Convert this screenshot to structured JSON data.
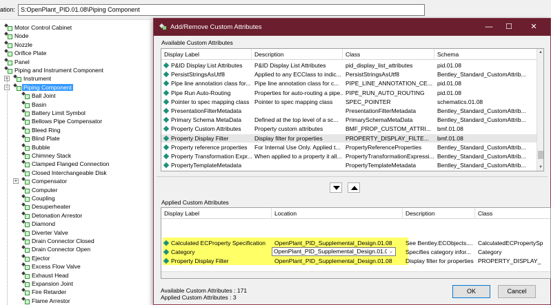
{
  "location": {
    "label": "ation:",
    "value": "S:OpenPlant_PID.01.08\\Piping Component"
  },
  "tree": {
    "items": [
      {
        "label": "Motor Control Cabinet",
        "level": 0
      },
      {
        "label": "Node",
        "level": 0
      },
      {
        "label": "Nozzle",
        "level": 0
      },
      {
        "label": "Orifice Plate",
        "level": 0
      },
      {
        "label": "Panel",
        "level": 0
      },
      {
        "label": "Piping and Instrument Component",
        "level": 0
      },
      {
        "label": "Instrument",
        "level": 1
      },
      {
        "label": "Piping Component",
        "level": 1,
        "selected": true
      },
      {
        "label": "Ball Joint",
        "level": 2
      },
      {
        "label": "Basin",
        "level": 2
      },
      {
        "label": "Battery Limit Symbol",
        "level": 2
      },
      {
        "label": "Bellows Pipe Compensator",
        "level": 2
      },
      {
        "label": "Bleed Ring",
        "level": 2
      },
      {
        "label": "Blind Plate",
        "level": 2
      },
      {
        "label": "Bubble",
        "level": 2
      },
      {
        "label": "Chimney Stack",
        "level": 2
      },
      {
        "label": "Clamped Flanged Connection",
        "level": 2
      },
      {
        "label": "Closed Interchangeable Disk",
        "level": 2
      },
      {
        "label": "Compensator",
        "level": 2
      },
      {
        "label": "Computer",
        "level": 2
      },
      {
        "label": "Coupling",
        "level": 2
      },
      {
        "label": "Desuperheater",
        "level": 2
      },
      {
        "label": "Detonation Arrestor",
        "level": 2
      },
      {
        "label": "Diamond",
        "level": 2
      },
      {
        "label": "Diverter Valve",
        "level": 2
      },
      {
        "label": "Drain Connector Closed",
        "level": 2
      },
      {
        "label": "Drain Connector Open",
        "level": 2
      },
      {
        "label": "Ejector",
        "level": 2
      },
      {
        "label": "Excess Flow Valve",
        "level": 2
      },
      {
        "label": "Exhaust Head",
        "level": 2
      },
      {
        "label": "Expansion Joint",
        "level": 2
      },
      {
        "label": "Fire Retarder",
        "level": 2
      },
      {
        "label": "Flame Arrestor",
        "level": 2
      }
    ]
  },
  "dialog": {
    "title": "Add/Remove Custom Attributes",
    "minimize": "—",
    "maximize": "☐",
    "close": "✕",
    "available_label": "Available Custom Attributes",
    "applied_label": "Applied Custom Attributes",
    "available": {
      "columns": [
        "Display Label",
        "Description",
        "Class",
        "Schema"
      ],
      "rows": [
        [
          "P&ID Display List Attributes",
          "P&ID Display List Attributes",
          "pid_display_list_attributes",
          "pid.01.08"
        ],
        [
          "PersistStringsAsUtf8",
          "Applied to any ECClass to indic...",
          "PersistStringsAsUtf8",
          "Bentley_Standard_CustomAttrib..."
        ],
        [
          "Pipe line annotation class for...",
          "Pipe line annotation class for c...",
          "PIPE_LINE_ANNOTATION_CE...",
          "pid.01.08"
        ],
        [
          "Pipe Run Auto-Routing",
          "Properties for auto-routing a pipe...",
          "PIPE_RUN_AUTO_ROUTING",
          "pid.01.08"
        ],
        [
          "Pointer to spec mapping class",
          "Pointer to spec mapping class",
          "SPEC_POINTER",
          "schematics.01.08"
        ],
        [
          "PresentationFilterMetadata",
          "",
          "PresentationFilterMetadata",
          "Bentley_Standard_CustomAttrib..."
        ],
        [
          "Primary Schema MetaData",
          "Defined at the top level of a sc...",
          "PrimarySchemaMetaData",
          "Bentley_Standard_CustomAttrib..."
        ],
        [
          "Property Custom Attributes",
          "Property custom attributes",
          "BMF_PROP_CUSTOM_ATTRI...",
          "bmf.01.08"
        ],
        [
          "Property Display Filter",
          "Display filter for properties",
          "PROPERTY_DISPLAY_FILTE...",
          "bmf.01.08"
        ],
        [
          "Property reference properties",
          "For Internal Use Only.  Applied t...",
          "PropertyReferenceProperties",
          "Bentley_Standard_CustomAttrib..."
        ],
        [
          "Property Transformation Expr...",
          "When applied to a property it all...",
          "PropertyTransformationExpressi...",
          "Bentley_Standard_CustomAttrib..."
        ],
        [
          "PropertyTemplateMetadata",
          "",
          "PropertyTemplateMetadata",
          "Bentley_Standard_CustomAttrib..."
        ]
      ],
      "highlighted_row": 8
    },
    "applied": {
      "columns": [
        "Display Label",
        "Location",
        "Description",
        "Class"
      ],
      "rows": [
        [
          "Calculated ECProperty Specification",
          "OpenPlant_PID_Supplemental_Design.01.08",
          "See Bentley.ECObjects....",
          "CalculatedECPropertySp"
        ],
        [
          "Category",
          "OpenPlant_PID_Supplemental_Design.01.0",
          "Specifies category infor...",
          "Category"
        ],
        [
          "Property Display Filter",
          "OpenPlant_PID_Supplemental_Design.01.08",
          "Display filter for properties",
          "PROPERTY_DISPLAY_"
        ]
      ]
    },
    "status_available": "Available Custom Attributes : 171",
    "status_applied": "Applied Custom Attributes : 3",
    "ok_label": "OK",
    "cancel_label": "Cancel",
    "colors": {
      "titlebar": "#6b1e2e",
      "highlight": "#ffff66",
      "selection": "#3399ff"
    }
  }
}
